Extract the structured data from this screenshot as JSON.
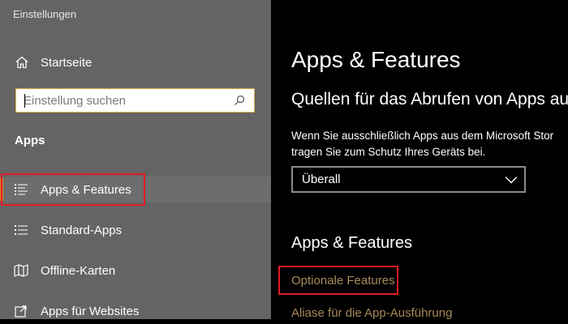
{
  "window": {
    "title": "Einstellungen"
  },
  "sidebar": {
    "home_label": "Startseite",
    "search_placeholder": "Einstellung suchen",
    "section_label": "Apps",
    "items": [
      {
        "label": "Apps & Features",
        "icon": "list-icon",
        "active": true
      },
      {
        "label": "Standard-Apps",
        "icon": "list-icon"
      },
      {
        "label": "Offline-Karten",
        "icon": "map-icon"
      },
      {
        "label": "Apps für Websites",
        "icon": "external-link-icon"
      }
    ]
  },
  "main": {
    "title": "Apps & Features",
    "subtitle": "Quellen für das Abrufen von Apps aus",
    "description_line1": "Wenn Sie ausschließlich Apps aus dem Microsoft Stor",
    "description_line2": "tragen Sie zum Schutz Ihres Geräts bei.",
    "dropdown_value": "Überall",
    "section_title": "Apps & Features",
    "links": [
      {
        "label": "Optionale Features"
      },
      {
        "label": "Aliase für die App-Ausführung"
      }
    ]
  },
  "colors": {
    "sidebar_bg": "#646464",
    "main_bg": "#000000",
    "accent": "#d98b2b",
    "link": "#a78a59",
    "highlight_border": "#e31b23"
  }
}
